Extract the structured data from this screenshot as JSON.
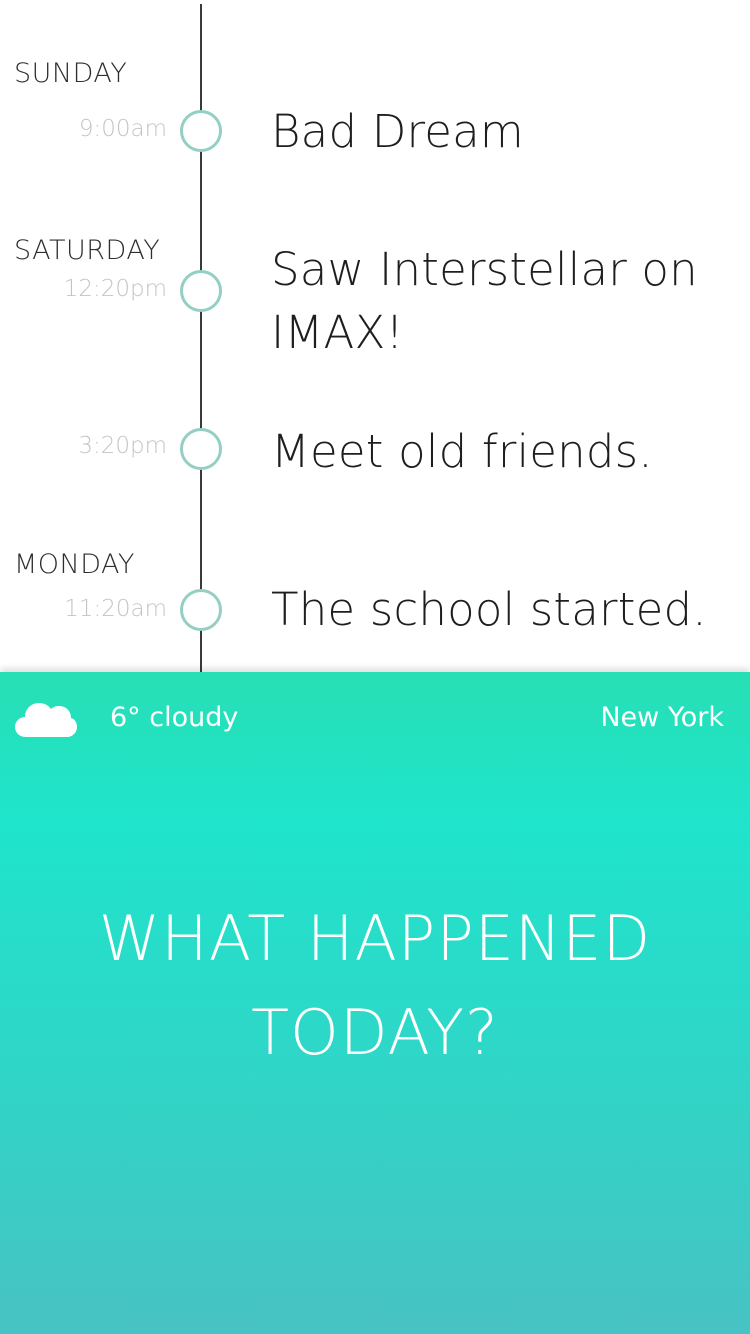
{
  "timeline": {
    "entries": [
      {
        "day": "SUNDAY",
        "time": "9:00am",
        "title": "Bad Dream"
      },
      {
        "day": "SATURDAY",
        "time": "12:20pm",
        "title": "Saw Interstellar on IMAX!"
      },
      {
        "day": "",
        "time": "3:20pm",
        "title": "Meet old friends."
      },
      {
        "day": "MONDAY",
        "time": "11:20am",
        "title": "The school started."
      }
    ]
  },
  "weather": {
    "icon": "cloud-icon",
    "summary": "6° cloudy",
    "location": "New York"
  },
  "prompt": {
    "line1": "WHAT HAPPENED",
    "line2": "TODAY?"
  },
  "colors": {
    "accent": "#27dfb4",
    "node_ring": "#95cfc4"
  }
}
